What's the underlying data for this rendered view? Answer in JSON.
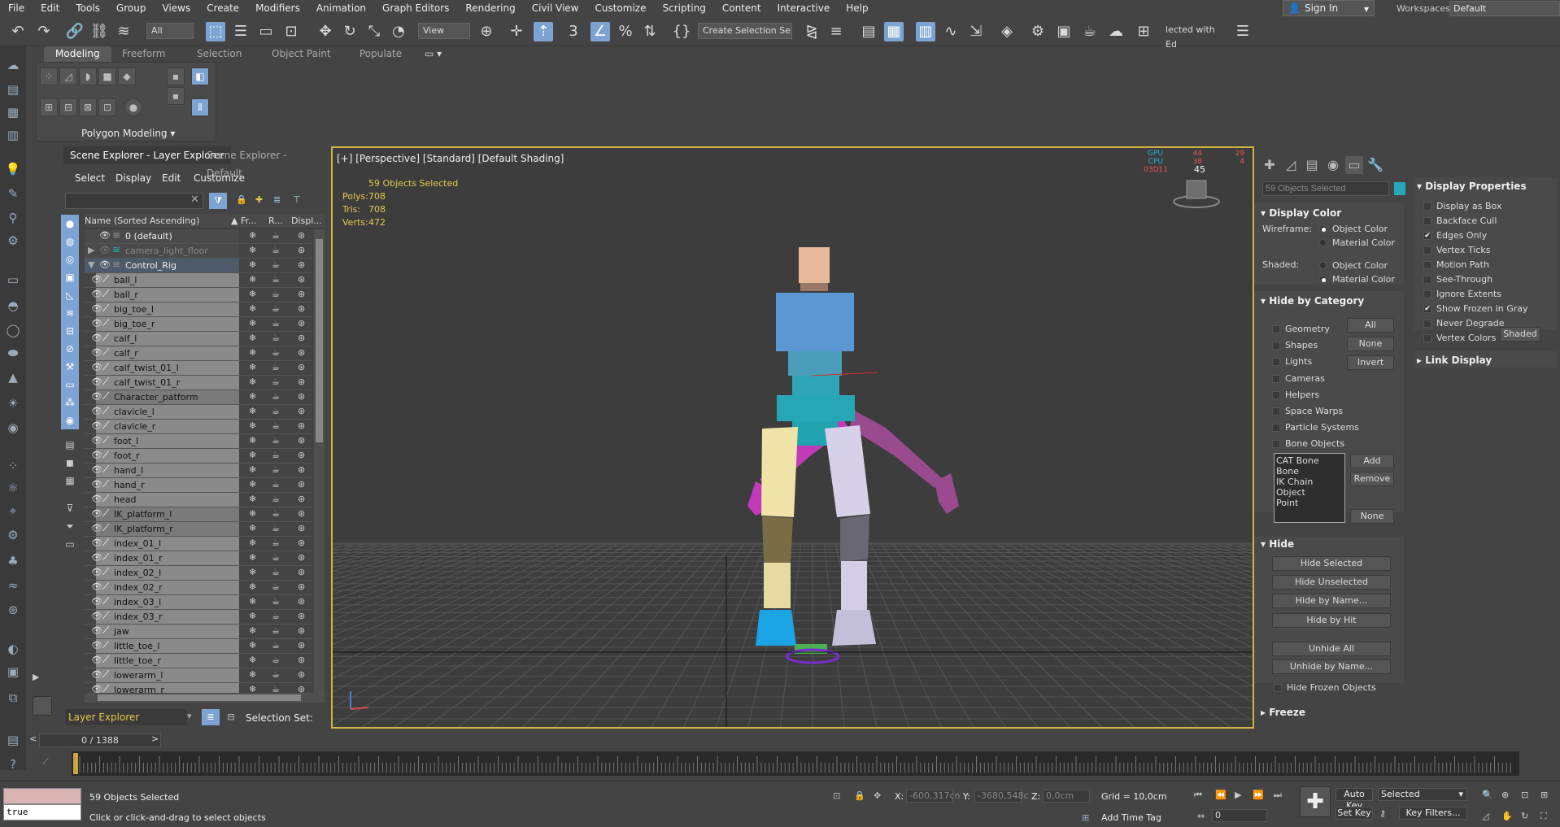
{
  "menubar": {
    "items": [
      "File",
      "Edit",
      "Tools",
      "Group",
      "Views",
      "Create",
      "Modifiers",
      "Animation",
      "Graph Editors",
      "Rendering",
      "Civil View",
      "Customize",
      "Scripting",
      "Content",
      "Interactive",
      "Help"
    ],
    "sign_in": "Sign In",
    "workspaces_label": "Workspaces:",
    "workspaces_value": "Default"
  },
  "toolbar": {
    "filter_value": "All",
    "view_value": "View",
    "selection_set": "Create Selection Se",
    "selected_with": "lected with Ed"
  },
  "ribbon": {
    "tabs": [
      "Modeling",
      "Freeform",
      "Selection",
      "Object Paint",
      "Populate"
    ],
    "panel_label": "Polygon Modeling"
  },
  "scene_explorer": {
    "tabs": [
      "Scene Explorer - Layer Explorer",
      "Scene Explorer - Default"
    ],
    "menu": [
      "Select",
      "Display",
      "Edit",
      "Customize"
    ],
    "columns": {
      "name": "Name (Sorted Ascending)",
      "frozen": "Fr...",
      "render": "R...",
      "display": "Displ..."
    },
    "layers": [
      {
        "name": "0 (default)"
      },
      {
        "name": "camera_light_floor"
      },
      {
        "name": "Control_Rig"
      }
    ],
    "objects": [
      "ball_l",
      "ball_r",
      "big_toe_l",
      "big_toe_r",
      "calf_l",
      "calf_r",
      "calf_twist_01_l",
      "calf_twist_01_r",
      "Character_patform",
      "clavicle_l",
      "clavicle_r",
      "foot_l",
      "foot_r",
      "hand_l",
      "hand_r",
      "head",
      "IK_platform_l",
      "IK_platform_r",
      "index_01_l",
      "index_01_r",
      "index_02_l",
      "index_02_r",
      "index_03_l",
      "index_03_r",
      "jaw",
      "little_toe_l",
      "little_toe_r",
      "lowerarm_l",
      "lowerarm_r"
    ],
    "layer_explorer": "Layer Explorer",
    "selection_set_label": "Selection Set:"
  },
  "viewport": {
    "label": "[+] [Perspective] [Standard] [Default Shading]",
    "selected_text": "59 Objects Selected",
    "stats": {
      "polys_label": "Polys:",
      "polys": "708",
      "tris_label": "Tris:",
      "tris": "708",
      "verts_label": "Verts:",
      "verts": "472"
    },
    "perf": {
      "gpu": "GPU",
      "cpu": "CPU",
      "time": "03D11",
      "gpu_val": "44",
      "cpu_val": "38",
      "fps": "45",
      "gpu_r": "29",
      "cpu_r": "4"
    }
  },
  "command_panel": {
    "selected_name": "59 Objects Selected",
    "display_color": {
      "title": "Display Color",
      "wireframe_label": "Wireframe:",
      "shaded_label": "Shaded:",
      "object_color": "Object Color",
      "material_color": "Material Color"
    },
    "hide_by_category": {
      "title": "Hide by Category",
      "items": [
        "Geometry",
        "Shapes",
        "Lights",
        "Cameras",
        "Helpers",
        "Space Warps",
        "Particle Systems",
        "Bone Objects"
      ],
      "btn_all": "All",
      "btn_none": "None",
      "btn_invert": "Invert",
      "list": [
        "CAT Bone",
        "Bone",
        "IK Chain Object",
        "Point"
      ],
      "btn_add": "Add",
      "btn_remove": "Remove",
      "btn_none2": "None"
    },
    "hide": {
      "title": "Hide",
      "buttons": [
        "Hide Selected",
        "Hide Unselected",
        "Hide by Name...",
        "Hide by Hit",
        "Unhide All",
        "Unhide by Name..."
      ],
      "hide_frozen": "Hide Frozen Objects"
    },
    "freeze_title": "Freeze",
    "display_properties": {
      "title": "Display Properties",
      "items": [
        {
          "label": "Display as Box",
          "checked": false
        },
        {
          "label": "Backface Cull",
          "checked": false
        },
        {
          "label": "Edges Only",
          "checked": true
        },
        {
          "label": "Vertex Ticks",
          "checked": false
        },
        {
          "label": "Motion Path",
          "checked": false
        },
        {
          "label": "See-Through",
          "checked": false
        },
        {
          "label": "Ignore Extents",
          "checked": false
        },
        {
          "label": "Show Frozen in Gray",
          "checked": true
        },
        {
          "label": "Never Degrade",
          "checked": false
        },
        {
          "label": "Vertex Colors",
          "checked": false
        }
      ],
      "shaded_btn": "Shaded"
    },
    "link_display": "Link Display",
    "check_mark": "✔"
  },
  "timeline": {
    "frame": "0 / 1388",
    "prev": "<",
    "next": ">"
  },
  "status": {
    "script_value": "true",
    "selected": "59 Objects Selected",
    "prompt": "Click or click-and-drag to select objects",
    "x_label": "X:",
    "x_value": "-600,317cn",
    "y_label": "Y:",
    "y_value": "-3680,548c",
    "z_label": "Z:",
    "z_value": "0,0cm",
    "grid": "Grid = 10,0cm",
    "add_time_tag": "Add Time Tag",
    "auto_key": "Auto Key",
    "auto_key_value": "Selected",
    "set_key": "Set Key",
    "key_filters": "Key Filters...",
    "frame_value": "0"
  },
  "colors": {
    "accent": "#7da3d3",
    "viewport_border": "#d3b443",
    "stats_text": "#e7c84a",
    "teal": "#25a9b9"
  }
}
